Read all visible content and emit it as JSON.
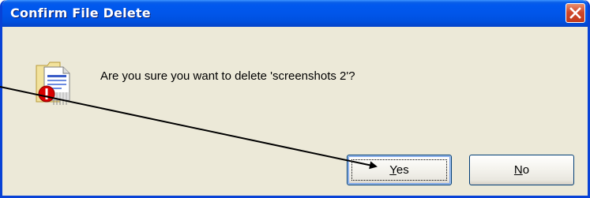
{
  "dialog": {
    "title": "Confirm File Delete",
    "message": "Are you sure you want to delete 'screenshots 2'?",
    "buttons": {
      "yes": {
        "label": "Yes",
        "mnemonic": "Y",
        "rest": "es"
      },
      "no": {
        "label": "No",
        "mnemonic": "N",
        "rest": "o"
      }
    },
    "icons": {
      "close": "close-icon",
      "message": "delete-file-warning-icon"
    },
    "colors": {
      "titlebar": "#0058ee",
      "frame": "#0842d6",
      "body": "#ece9d8",
      "close_button": "#d0482b",
      "warning_badge": "#d90000"
    }
  }
}
